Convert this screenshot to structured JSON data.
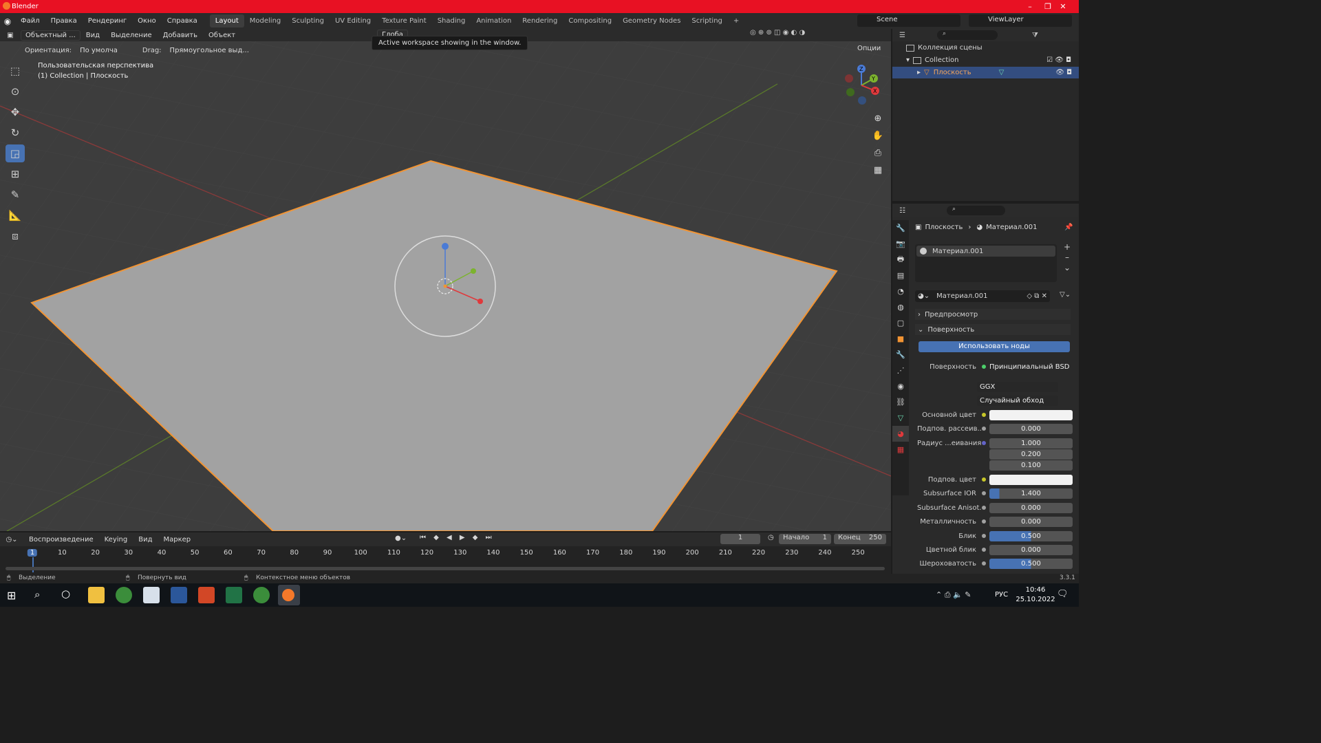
{
  "window": {
    "title": "Blender",
    "min": "–",
    "max": "❐",
    "close": "✕"
  },
  "menus": [
    "Файл",
    "Правка",
    "Рендеринг",
    "Окно",
    "Справка"
  ],
  "workspaces": [
    "Layout",
    "Modeling",
    "Sculpting",
    "UV Editing",
    "Texture Paint",
    "Shading",
    "Animation",
    "Rendering",
    "Compositing",
    "Geometry Nodes",
    "Scripting"
  ],
  "scene": {
    "name": "Scene",
    "view_layer": "ViewLayer"
  },
  "viewport_header": {
    "mode": "Объектный ...",
    "items": [
      "Вид",
      "Выделение",
      "Добавить",
      "Объект"
    ],
    "global": "Глоба",
    "orientation_label": "Ориентация:",
    "orientation": "По умолча",
    "drag_label": "Drag:",
    "drag_value": "Прямоугольное выд...",
    "options": "Опции"
  },
  "tooltip": "Active workspace showing in the window.",
  "viewport": {
    "line1": "Пользовательская перспектива",
    "line2": "(1) Collection | Плоскость"
  },
  "outliner": {
    "root": "Коллекция сцены",
    "collection": "Collection",
    "object": "Плоскость"
  },
  "properties": {
    "breadcrumb_obj": "Плоскость",
    "breadcrumb_mat": "Материал.001",
    "slot": "Материал.001",
    "material_name": "Материал.001",
    "section_preview": "Предпросмотр",
    "section_surface": "Поверхность",
    "use_nodes": "Использовать ноды",
    "surface_label": "Поверхность",
    "surface_value": "Принципиальный BSD",
    "distribution": "GGX",
    "subsurface_method": "Случайный обход",
    "rows": [
      {
        "label": "Основной цвет",
        "value": "",
        "kind": "color",
        "sock": "#c7c729"
      },
      {
        "label": "Подпов. рассеив...",
        "value": "0.000",
        "kind": "num",
        "sock": "#a1a1a1"
      },
      {
        "label": "Радиус ...еивания",
        "value": "1.000",
        "kind": "num",
        "sock": "#6363c7"
      },
      {
        "label": "",
        "value": "0.200",
        "kind": "num",
        "sock": ""
      },
      {
        "label": "",
        "value": "0.100",
        "kind": "num",
        "sock": ""
      },
      {
        "label": "Подпов. цвет",
        "value": "",
        "kind": "color",
        "sock": "#c7c729"
      },
      {
        "label": "Subsurface IOR",
        "value": "1.400",
        "kind": "num",
        "sock": "#a1a1a1"
      },
      {
        "label": "Subsurface Anisot...",
        "value": "0.000",
        "kind": "num",
        "sock": "#a1a1a1"
      },
      {
        "label": "Металличность",
        "value": "0.000",
        "kind": "num",
        "sock": "#a1a1a1"
      },
      {
        "label": "Блик",
        "value": "0.500",
        "kind": "num",
        "sock": "#a1a1a1"
      },
      {
        "label": "Цветной блик",
        "value": "0.000",
        "kind": "num",
        "sock": "#a1a1a1"
      },
      {
        "label": "Шероховатость",
        "value": "0.500",
        "kind": "num",
        "sock": "#a1a1a1"
      }
    ]
  },
  "timeline": {
    "menus": [
      "Воспроизведение",
      "Keying",
      "Вид",
      "Маркер"
    ],
    "current_frame": "1",
    "start_label": "Начало",
    "start": "1",
    "end_label": "Конец",
    "end": "250",
    "ticks": [
      "1",
      "10",
      "20",
      "30",
      "40",
      "50",
      "60",
      "70",
      "80",
      "90",
      "100",
      "110",
      "120",
      "130",
      "140",
      "150",
      "160",
      "170",
      "180",
      "190",
      "200",
      "210",
      "220",
      "230",
      "240",
      "250"
    ]
  },
  "statusbar": {
    "select": "Выделение",
    "rotate": "Повернуть вид",
    "context": "Контекстное меню объектов",
    "version": "3.3.1"
  },
  "taskbar": {
    "lang": "РУС",
    "time": "10:46",
    "date": "25.10.2022"
  },
  "colors": {
    "accent": "#4772b3",
    "selection": "#f29433",
    "titlebar": "#e81123"
  }
}
